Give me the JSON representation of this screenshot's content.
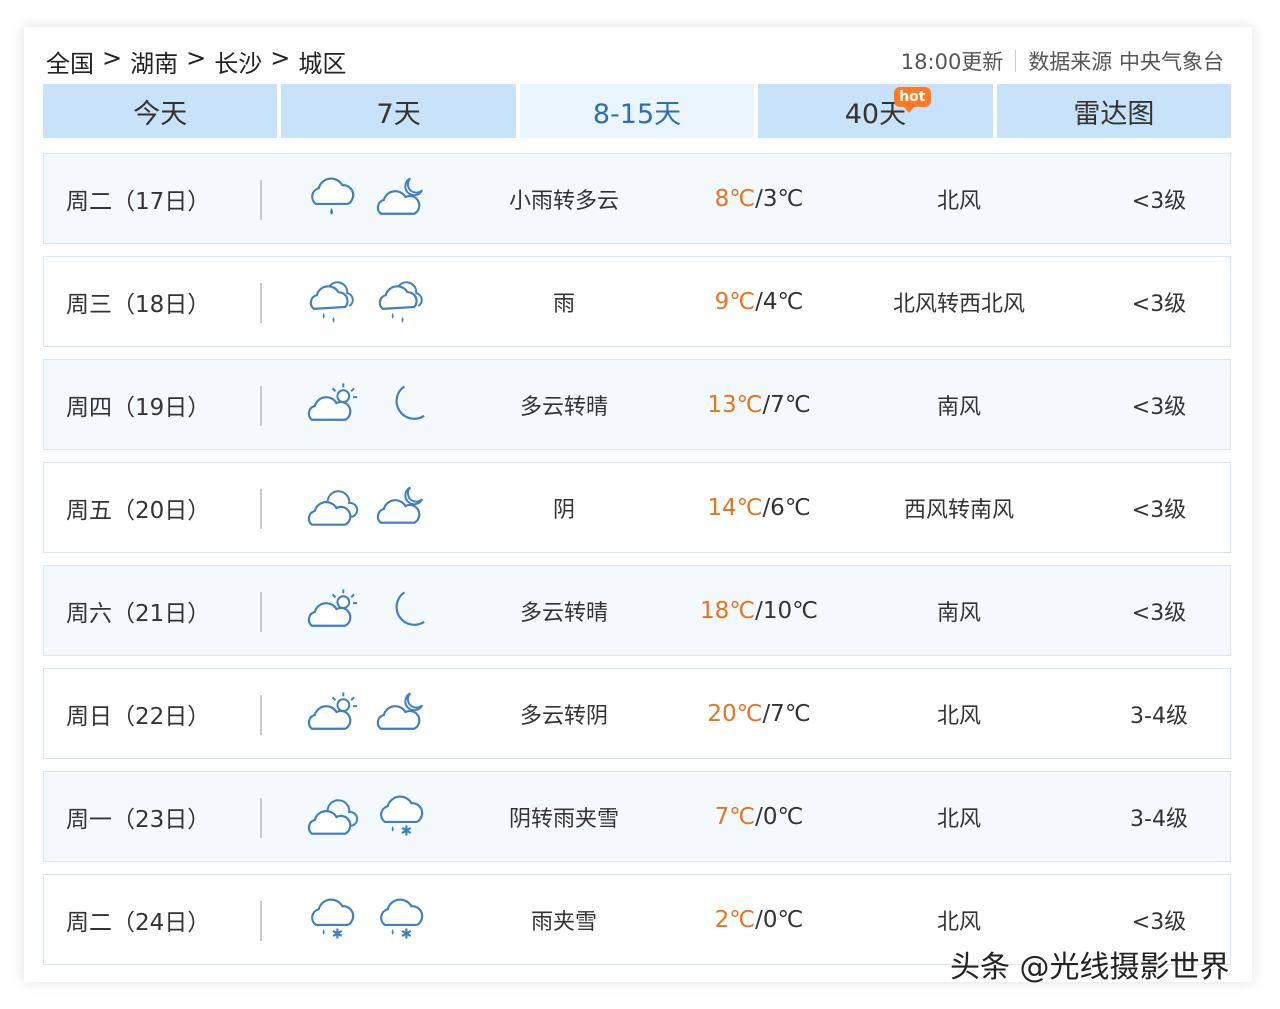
{
  "breadcrumb": [
    "全国",
    "湖南",
    "长沙",
    "城区"
  ],
  "breadcrumb_sep": ">",
  "source": {
    "update": "18:00更新",
    "label": "数据来源 中央气象台"
  },
  "tabs": [
    {
      "label": "今天"
    },
    {
      "label": "7天"
    },
    {
      "label": "8-15天"
    },
    {
      "label": "40天",
      "badge": "hot"
    },
    {
      "label": "雷达图"
    }
  ],
  "active_tab": 2,
  "colors": {
    "accent": "#2d6fb7",
    "tab_bg": "#c7e2f9",
    "high_temp": "#e8731c",
    "icon": "#3f7fbf"
  },
  "forecast": [
    {
      "day": "周二（17日）",
      "icons": [
        "rain-cloud-icon",
        "cloudy-night-icon"
      ],
      "desc": "小雨转多云",
      "high": "8℃",
      "low": "/3℃",
      "wind": "北风",
      "level": "<3级"
    },
    {
      "day": "周三（18日）",
      "icons": [
        "heavy-rain-cloud-icon",
        "heavy-rain-cloud-icon"
      ],
      "desc": "雨",
      "high": "9℃",
      "low": "/4℃",
      "wind": "北风转西北风",
      "level": "<3级"
    },
    {
      "day": "周四（19日）",
      "icons": [
        "partly-sunny-icon",
        "moon-icon"
      ],
      "desc": "多云转晴",
      "high": "13℃",
      "low": "/7℃",
      "wind": "南风",
      "level": "<3级"
    },
    {
      "day": "周五（20日）",
      "icons": [
        "overcast-cloud-icon",
        "cloudy-night-icon"
      ],
      "desc": "阴",
      "high": "14℃",
      "low": "/6℃",
      "wind": "西风转南风",
      "level": "<3级"
    },
    {
      "day": "周六（21日）",
      "icons": [
        "partly-sunny-icon",
        "moon-icon"
      ],
      "desc": "多云转晴",
      "high": "18℃",
      "low": "/10℃",
      "wind": "南风",
      "level": "<3级"
    },
    {
      "day": "周日（22日）",
      "icons": [
        "partly-sunny-icon",
        "cloudy-night-icon"
      ],
      "desc": "多云转阴",
      "high": "20℃",
      "low": "/7℃",
      "wind": "北风",
      "level": "3-4级"
    },
    {
      "day": "周一（23日）",
      "icons": [
        "overcast-cloud-icon",
        "sleet-cloud-icon"
      ],
      "desc": "阴转雨夹雪",
      "high": "7℃",
      "low": "/0℃",
      "wind": "北风",
      "level": "3-4级"
    },
    {
      "day": "周二（24日）",
      "icons": [
        "sleet-cloud-icon",
        "sleet-cloud-icon"
      ],
      "desc": "雨夹雪",
      "high": "2℃",
      "low": "/0℃",
      "wind": "北风",
      "level": "<3级"
    }
  ],
  "watermark": "头条 @光线摄影世界"
}
